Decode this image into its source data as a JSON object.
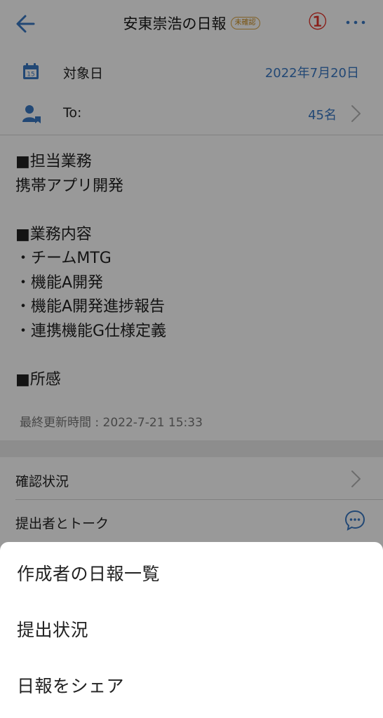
{
  "header": {
    "title": "安東崇浩の日報",
    "badge": "未確認",
    "annotation": "①"
  },
  "info": {
    "date_label": "対象日",
    "date_value": "2022年7月20日",
    "to_label": "To:",
    "to_value": "45名"
  },
  "report": {
    "lines": [
      "■担当業務",
      "携帯アプリ開発",
      "",
      "■業務内容",
      "・チームMTG",
      "・機能A開発",
      "・機能A開発進捗報告",
      "・連携機能G仕様定義",
      "",
      "■所感"
    ],
    "updated": "最終更新時間 : 2022-7-21 15:33"
  },
  "list": {
    "confirm_status": "確認状況",
    "talk": "提出者とトーク"
  },
  "sheet": {
    "items": [
      "作成者の日報一覧",
      "提出状況",
      "日報をシェア"
    ]
  },
  "icons": {
    "back": "arrow-left-icon",
    "more": "more-horizontal-icon",
    "date": "calendar-icon",
    "to": "person-icon",
    "chevron": "chevron-right-icon",
    "talk": "chat-bubble-icon"
  },
  "colors": {
    "accent": "#3a78c4",
    "annotation": "#e5332a",
    "badge": "#d9a443"
  }
}
